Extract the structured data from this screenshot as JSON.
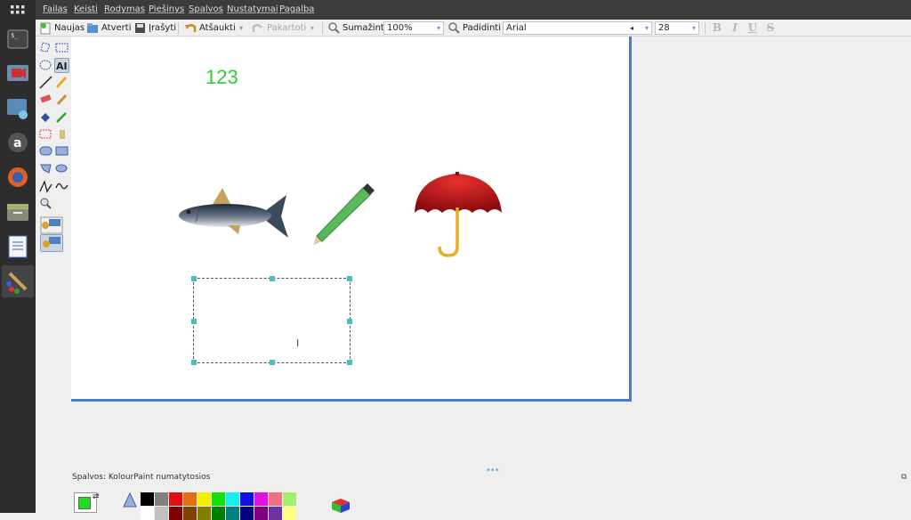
{
  "menu": [
    "Failas",
    "Keisti",
    "Rodymas",
    "Piešinys",
    "Spalvos",
    "Nustatymai",
    "Pagalba"
  ],
  "toolbar": {
    "new": "Naujas",
    "open": "Atverti",
    "save": "Įrašyti",
    "undo": "Atšaukti",
    "redo": "Pakartoti",
    "zoom_out": "Sumažinti",
    "zoom_value": "100%",
    "zoom_in": "Padidinti",
    "font": "Arial",
    "font_size": "28"
  },
  "canvas": {
    "text": "123",
    "text_color": "#2ecc2e"
  },
  "palette": {
    "label": "Spalvos: KolourPaint numatytosios",
    "foreground": "#19e019",
    "background": "#ffffff",
    "row1": [
      "#000000",
      "#808080",
      "#e01010",
      "#e07010",
      "#f0f000",
      "#10e010",
      "#10f0f0",
      "#1010e0",
      "#e010e0",
      "#f07080",
      "#a0f070"
    ],
    "row2": [
      "#ffffff",
      "#c0c0c0",
      "#800000",
      "#804000",
      "#808000",
      "#008000",
      "#008080",
      "#000080",
      "#800080",
      "#7030a0",
      "#ffff80"
    ]
  },
  "icons": [
    "launcher-grid-icon",
    "terminal-icon",
    "video-icon",
    "screenshot-icon",
    "amazon-icon",
    "firefox-icon",
    "files-icon",
    "writer-icon",
    "kolourpaint-icon"
  ]
}
